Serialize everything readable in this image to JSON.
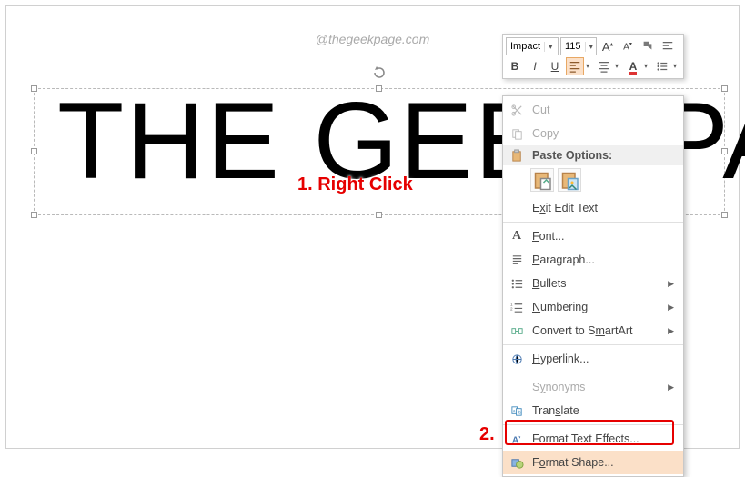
{
  "watermark": "@thegeekpage.com",
  "mainText": "THE GEEK PA",
  "annotations": {
    "step1": "1. Right Click",
    "step2": "2."
  },
  "miniToolbar": {
    "fontName": "Impact",
    "fontSize": "115",
    "increaseFont": "A",
    "decreaseFont": "A",
    "bold": "B",
    "italic": "I",
    "underline": "U"
  },
  "contextMenu": {
    "cut": "Cut",
    "copy": "Copy",
    "pasteHeader": "Paste Options:",
    "exitEdit": "Exit Edit Text",
    "font": "Font...",
    "paragraph": "Paragraph...",
    "bullets": "Bullets",
    "numbering": "Numbering",
    "smartart": "Convert to SmartArt",
    "hyperlink": "Hyperlink...",
    "synonyms": "Synonyms",
    "translate": "Translate",
    "textEffects": "Format Text Effects...",
    "formatShape": "Format Shape..."
  }
}
